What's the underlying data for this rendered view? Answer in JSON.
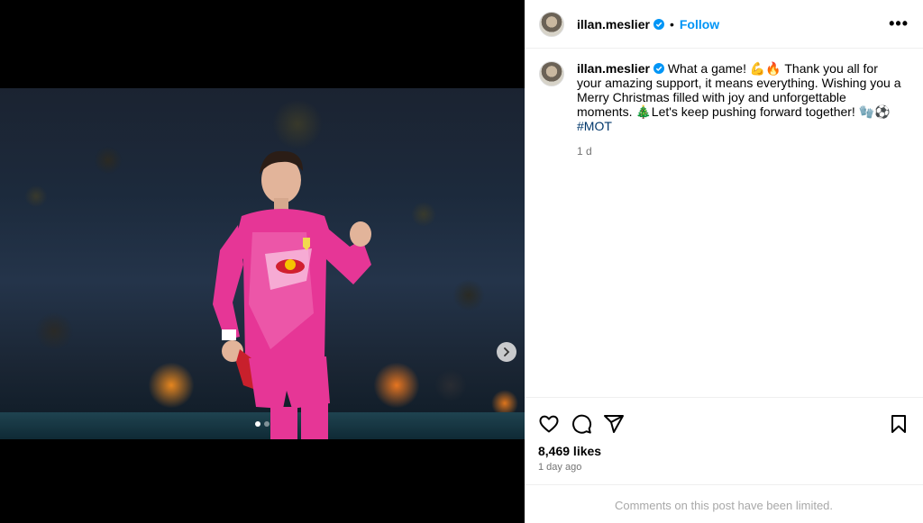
{
  "post": {
    "username": "illan.meslier",
    "follow_label": "Follow",
    "separator": "•",
    "more_label": "•••",
    "caption_text": "What a game! 💪🔥 Thank you all for your amazing support, it means everything. Wishing you a Merry Christmas filled with joy and unforgettable moments. 🎄Let's keep pushing forward together! 🧤⚽ ",
    "hashtag": "#MOT",
    "caption_time": "1 d",
    "likes": "8,469 likes",
    "time_ago": "1 day ago",
    "comments_limited": "Comments on this post have been limited."
  },
  "carousel": {
    "current_index": 1,
    "total": 2
  },
  "icons": {
    "verified": "verified-badge-icon",
    "like": "heart-icon",
    "comment": "comment-icon",
    "share": "share-icon",
    "save": "bookmark-icon",
    "next": "chevron-right-icon"
  },
  "colors": {
    "link": "#0095f6",
    "hashtag": "#00376b",
    "kit_pink": "#e8339b",
    "muted": "#737373"
  }
}
